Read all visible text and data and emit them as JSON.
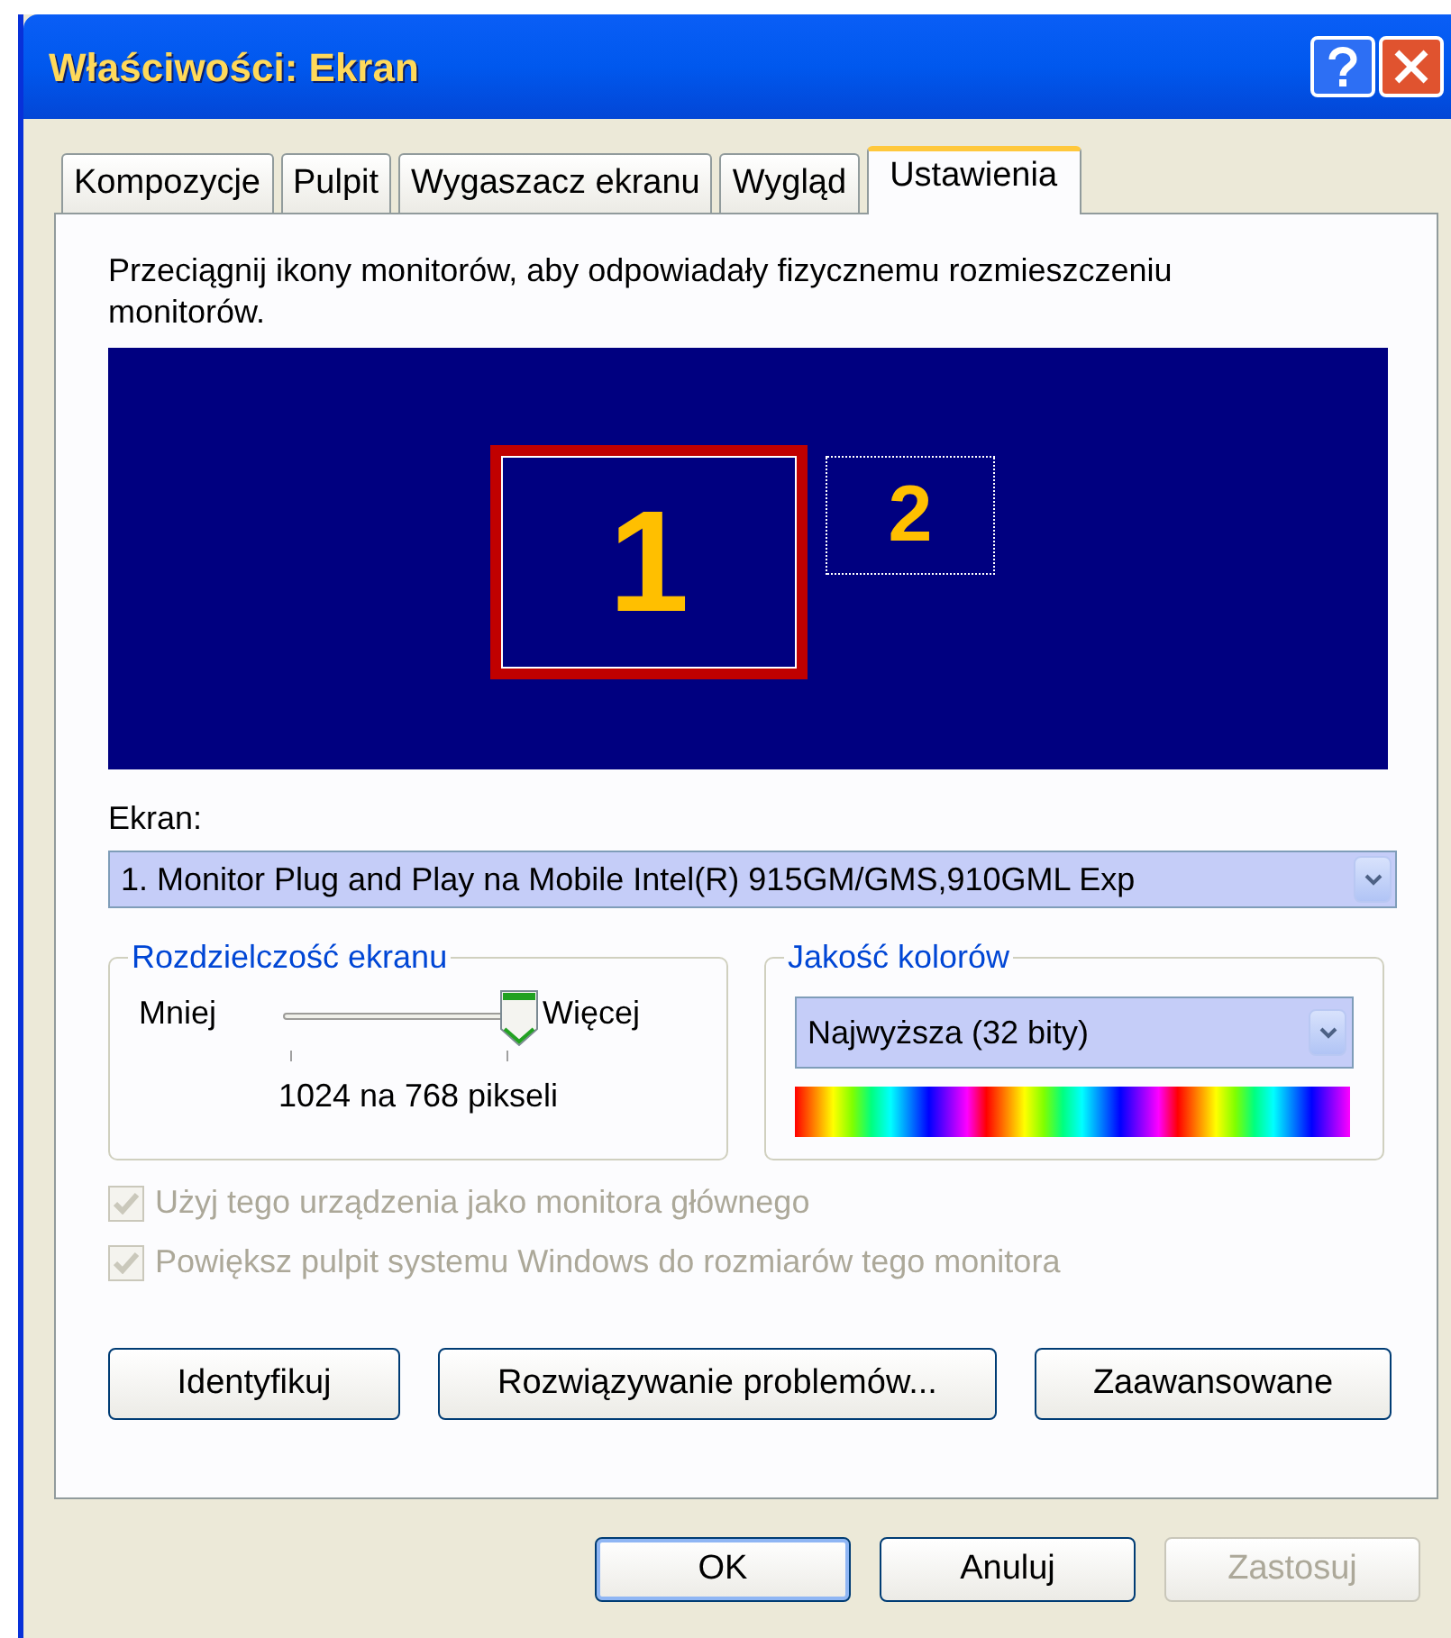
{
  "window": {
    "title": "Właściwości: Ekran"
  },
  "tabs": [
    {
      "label": "Kompozycje",
      "selected": false
    },
    {
      "label": "Pulpit",
      "selected": false
    },
    {
      "label": "Wygaszacz ekranu",
      "selected": false
    },
    {
      "label": "Wygląd",
      "selected": false
    },
    {
      "label": "Ustawienia",
      "selected": true
    }
  ],
  "instruction": "Przeciągnij ikony monitorów, aby odpowiadały fizycznemu rozmieszczeniu monitorów.",
  "monitors": [
    {
      "label": "1",
      "selected": true,
      "attached": true
    },
    {
      "label": "2",
      "selected": false,
      "attached": false
    }
  ],
  "display": {
    "label": "Ekran:",
    "value": "1. Monitor Plug and Play na Mobile Intel(R) 915GM/GMS,910GML Exp"
  },
  "resolution": {
    "legend": "Rozdzielczość ekranu",
    "min_label": "Mniej",
    "max_label": "Więcej",
    "level": 1,
    "reading": "1024 na 768 pikseli"
  },
  "color_quality": {
    "legend": "Jakość kolorów",
    "value": "Najwyższa (32 bity)"
  },
  "checkboxes": [
    {
      "label": "Użyj tego urządzenia jako monitora głównego",
      "checked": true,
      "disabled": true
    },
    {
      "label": "Powiększ pulpit systemu Windows do rozmiarów tego monitora",
      "checked": true,
      "disabled": true
    }
  ],
  "panel_buttons": [
    "Identyfikuj",
    "Rozwiązywanie problemów...",
    "Zaawansowane"
  ],
  "dialog_buttons": [
    {
      "label": "OK",
      "kind": "default",
      "disabled": false
    },
    {
      "label": "Anuluj",
      "kind": "normal",
      "disabled": false
    },
    {
      "label": "Zastosuj",
      "kind": "normal",
      "disabled": true
    }
  ]
}
